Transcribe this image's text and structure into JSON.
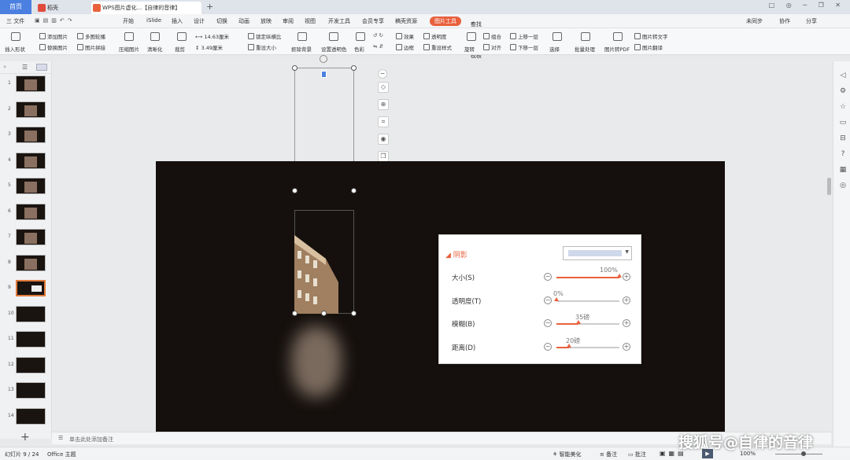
{
  "tabs": {
    "home": "首页",
    "daoke": "稻壳",
    "doc_title": "WPS图片虚化...【自律的音律】"
  },
  "menu": [
    "三 文件",
    "开始",
    "iSlide",
    "插入",
    "设计",
    "切换",
    "动画",
    "放映",
    "审阅",
    "视图",
    "开发工具",
    "会员专享",
    "稿壳资源",
    "图片工具"
  ],
  "search_placeholder": "查找命令、搜索模板",
  "topright": {
    "sync": "未同步",
    "collab": "协作",
    "share": "分享"
  },
  "ribbon": {
    "insert_shape": "插入形状",
    "add_pic": "添加图片",
    "multi_pic": "多图轮播",
    "replace_pic": "替换图片",
    "pic_concat": "图片拼接",
    "compress": "压缩图片",
    "sharpen": "清晰化",
    "crop": "裁剪",
    "width": "14.63厘米",
    "height": "3.49厘米",
    "lock_ratio": "锁定纵横比",
    "reset_size": "重设大小",
    "matting": "抠除背景",
    "set_transparent": "设置透明色",
    "color": "色彩",
    "effects": "效果",
    "transparency": "透明度",
    "border": "边框",
    "reset_style": "重设样式",
    "rotate": "旋转",
    "group": "组合",
    "align": "对齐",
    "up_layer": "上移一层",
    "down_layer": "下移一层",
    "select": "选择",
    "batch": "批量处理",
    "pic_to_pdf": "图片转PDF",
    "pic_to_text": "图片转文字",
    "pic_translate": "图片翻译"
  },
  "slides": {
    "numbers": [
      "1",
      "2",
      "3",
      "4",
      "5",
      "6",
      "7",
      "8",
      "9",
      "10",
      "11",
      "12",
      "13",
      "14"
    ],
    "selected": "9",
    "add": "+"
  },
  "notes_placeholder": "单击此处添加备注",
  "shadow_panel": {
    "title": "阴影",
    "rows": [
      {
        "label": "大小(S)",
        "value": "100%",
        "fraction": 1.0
      },
      {
        "label": "透明度(T)",
        "value": "0%",
        "fraction": 0.0
      },
      {
        "label": "模糊(B)",
        "value": "35磅",
        "fraction": 0.35
      },
      {
        "label": "距离(D)",
        "value": "20磅",
        "fraction": 0.2
      }
    ],
    "accent": "#e8603c"
  },
  "status": {
    "slide_pos": "幻灯片 9 / 24",
    "theme": "Office 主题",
    "smart": "智能美化",
    "notes": "备注",
    "comment": "批注",
    "zoom": "100%"
  },
  "watermark": "搜狐号@自律的音律"
}
